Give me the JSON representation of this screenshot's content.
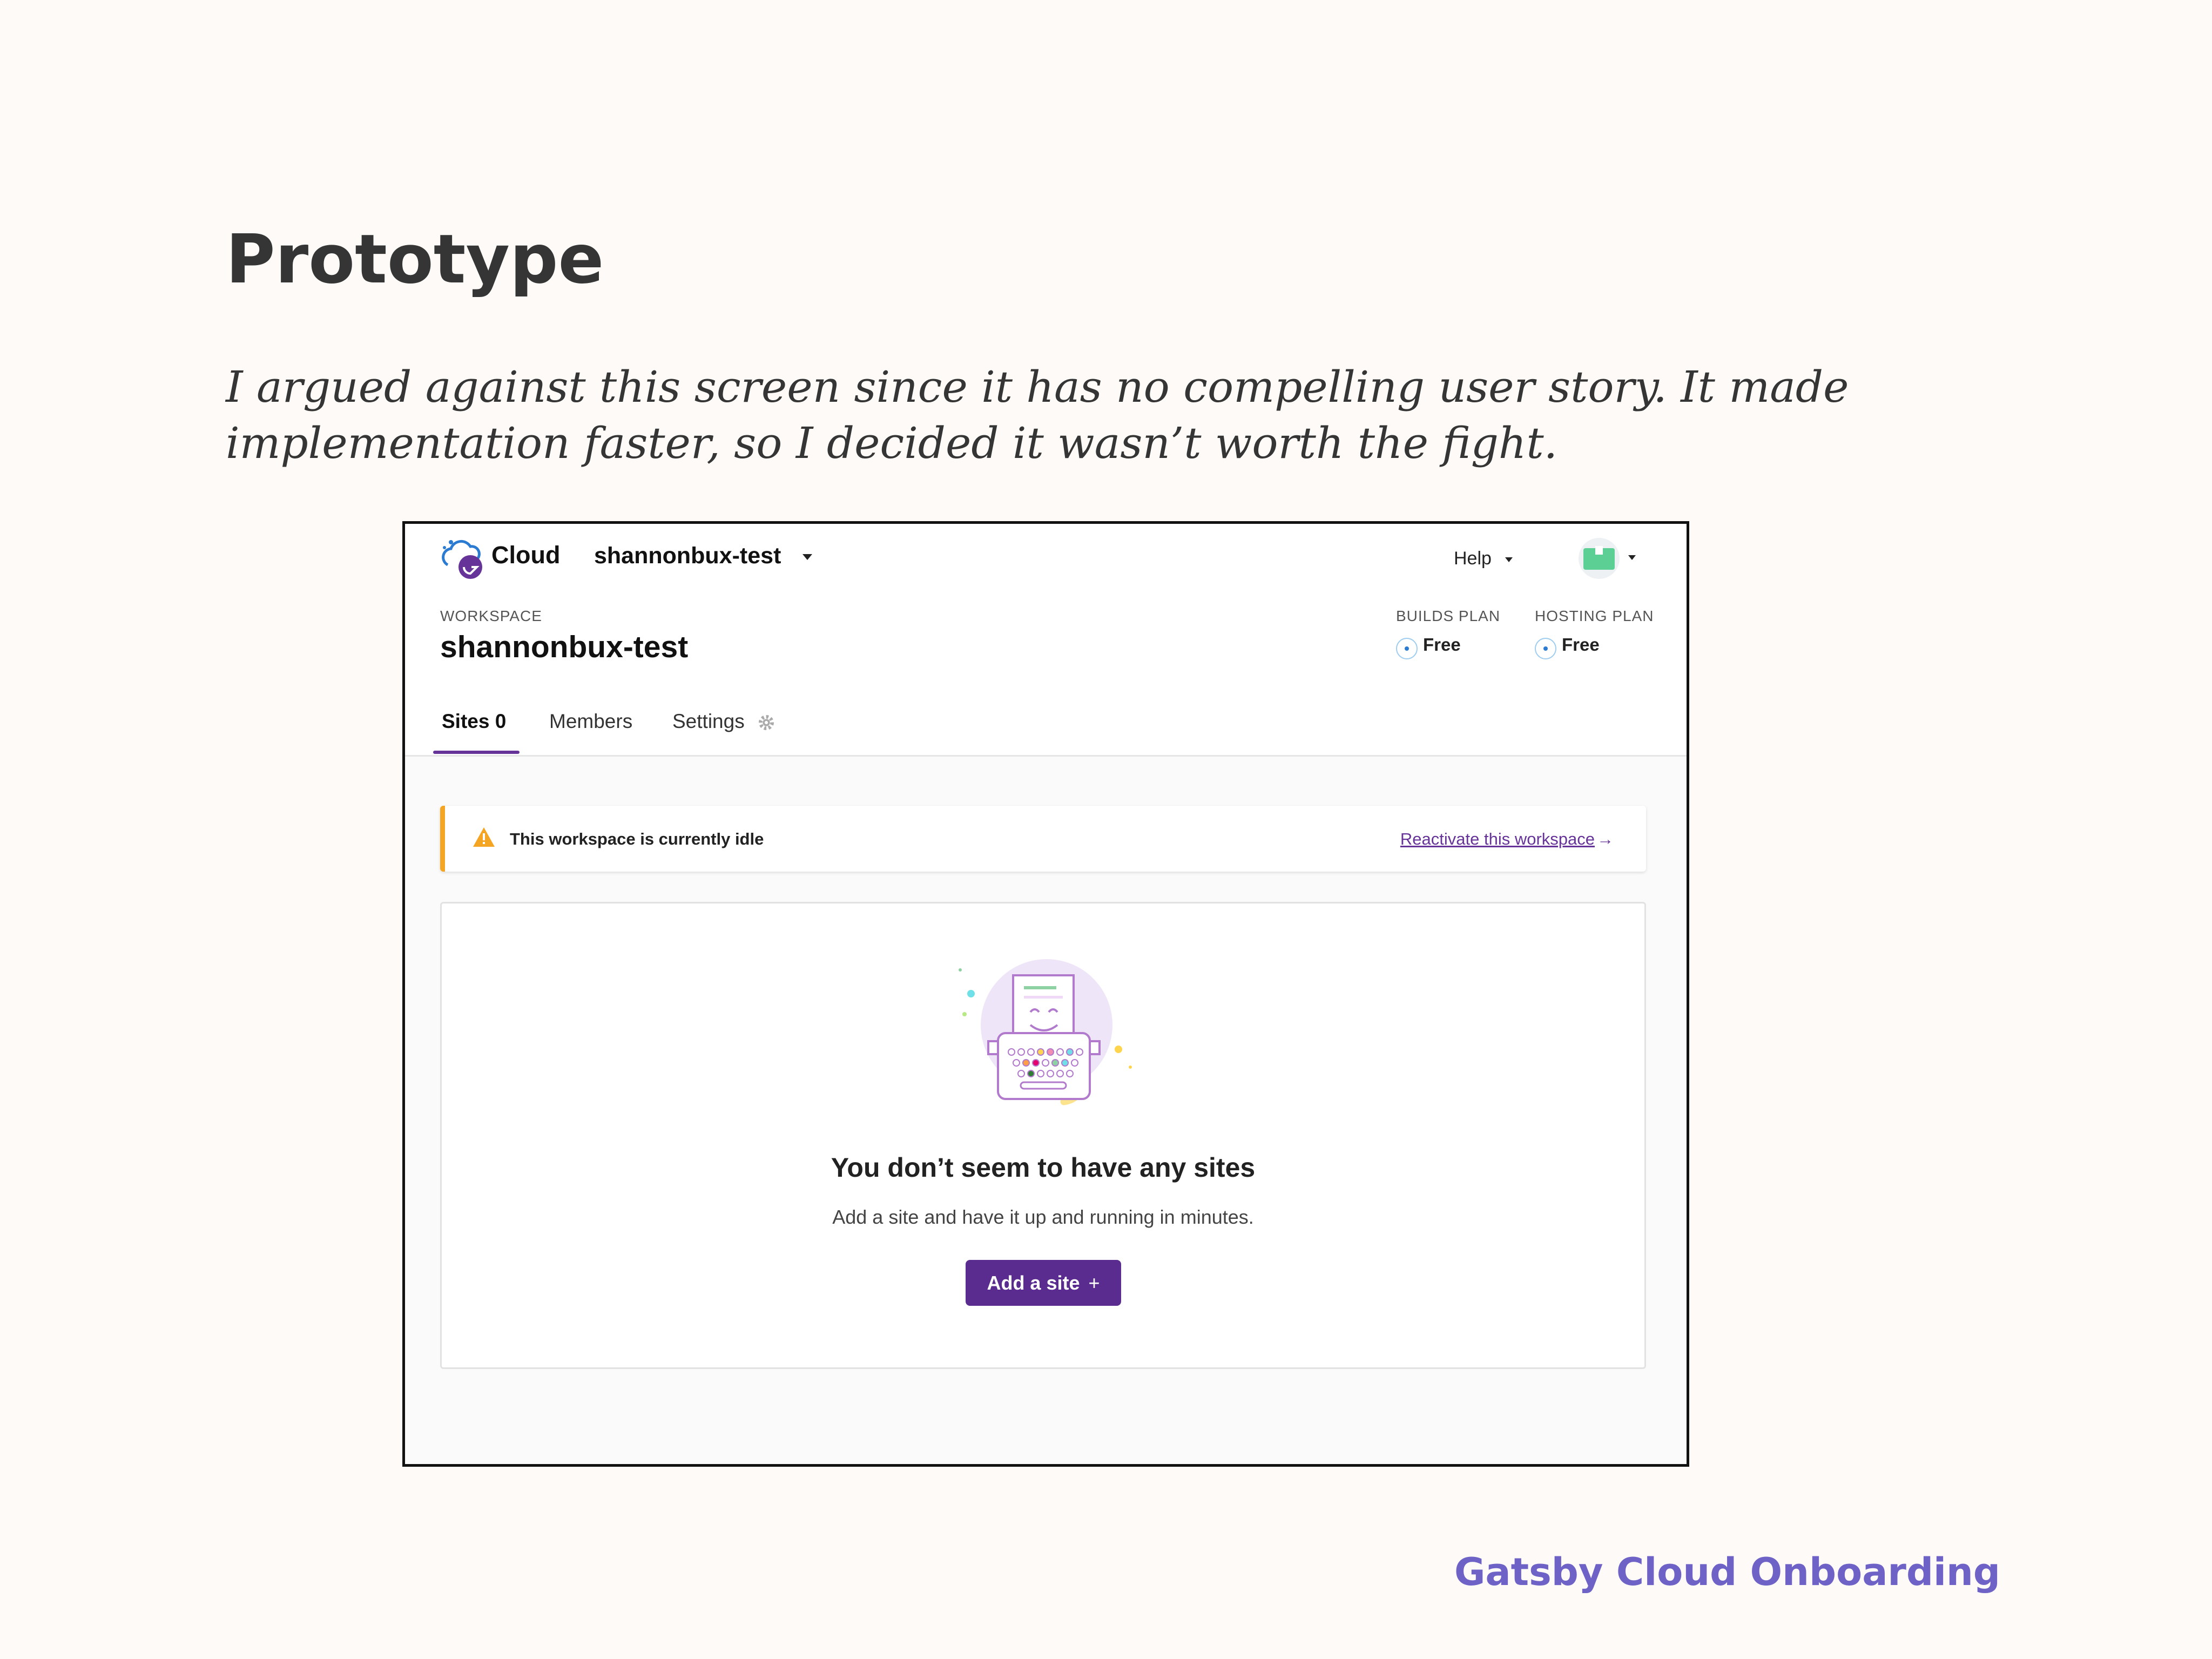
{
  "slide": {
    "title": "Prototype",
    "note": "I argued against this screen since it has no compelling user story.  It made implementation faster, so I decided it wasn’t worth the fight.",
    "footer": "Gatsby Cloud Onboarding"
  },
  "app": {
    "brand": "Cloud",
    "workspace_switcher": "shannonbux-test",
    "help_label": "Help",
    "workspace_label": "WORKSPACE",
    "workspace_name": "shannonbux-test",
    "builds_plan_label": "BUILDS PLAN",
    "builds_plan_value": "Free",
    "hosting_plan_label": "HOSTING PLAN",
    "hosting_plan_value": "Free",
    "tabs": [
      {
        "label": "Sites 0",
        "active": true
      },
      {
        "label": "Members",
        "active": false
      },
      {
        "label": "Settings",
        "active": false
      }
    ],
    "alert": {
      "message": "This workspace is currently idle",
      "link": "Reactivate this workspace"
    },
    "empty_state": {
      "title": "You don’t seem to have any sites",
      "subtitle": "Add a site and have it up and running in minutes.",
      "button": "Add a site"
    }
  },
  "colors": {
    "accent": "#663399",
    "button": "#5b2c8f",
    "alert_bar": "#f5a524",
    "footer_text": "#6e62c7",
    "avatar": "#5ccf95"
  },
  "icons": [
    "gatsby-cloud-logo-icon",
    "caret-down-icon",
    "warning-icon",
    "arrow-right-icon",
    "gear-icon",
    "plus-icon",
    "typewriter-illustration"
  ]
}
